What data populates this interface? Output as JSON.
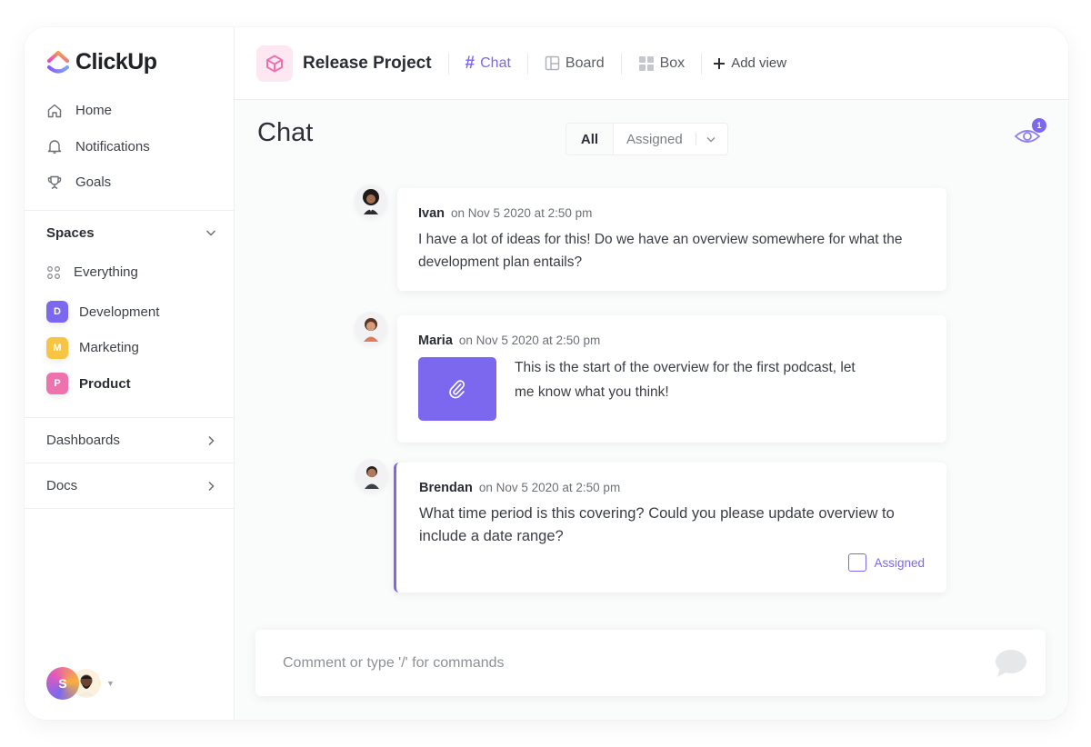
{
  "app": {
    "name": "ClickUp"
  },
  "sidebar": {
    "nav": [
      {
        "label": "Home",
        "icon": "home-icon"
      },
      {
        "label": "Notifications",
        "icon": "bell-icon"
      },
      {
        "label": "Goals",
        "icon": "trophy-icon"
      }
    ],
    "spaces": {
      "header": "Spaces",
      "everything": "Everything",
      "items": [
        {
          "letter": "D",
          "label": "Development",
          "color": "#7b68ee"
        },
        {
          "letter": "M",
          "label": "Marketing",
          "color": "#f7c544"
        },
        {
          "letter": "P",
          "label": "Product",
          "color": "#ee72ad"
        }
      ]
    },
    "dashboards": "Dashboards",
    "docs": "Docs",
    "user_initial": "S"
  },
  "header": {
    "project": "Release Project",
    "tabs": [
      {
        "label": "Chat",
        "icon": "hash-icon",
        "active": true
      },
      {
        "label": "Board",
        "icon": "board-icon",
        "active": false
      },
      {
        "label": "Box",
        "icon": "box-grid-icon",
        "active": false
      }
    ],
    "add_view": "Add view"
  },
  "chat": {
    "title": "Chat",
    "filters": {
      "all": "All",
      "assigned": "Assigned"
    },
    "watchers_count": "1",
    "messages": [
      {
        "author": "Ivan",
        "time": "on Nov 5 2020 at 2:50 pm",
        "text": "I have a lot of ideas for this! Do we have an overview somewhere for what the development plan entails?"
      },
      {
        "author": "Maria",
        "time": "on Nov 5 2020 at 2:50 pm",
        "text": "This is the start of the overview for the first podcast, let me know what you think!",
        "attachment": true
      },
      {
        "author": "Brendan",
        "time": "on Nov 5 2020 at 2:50 pm",
        "text": "What time period is this covering? Could you please update overview to include a date range?",
        "assigned_label": "Assigned",
        "assigned_checked": false
      }
    ],
    "composer": {
      "placeholder": "Comment or type '/' for commands",
      "value": ""
    }
  },
  "colors": {
    "accent": "#7b68ee",
    "project_bg": "#fde8f2",
    "project_icon": "#ee72ad"
  }
}
